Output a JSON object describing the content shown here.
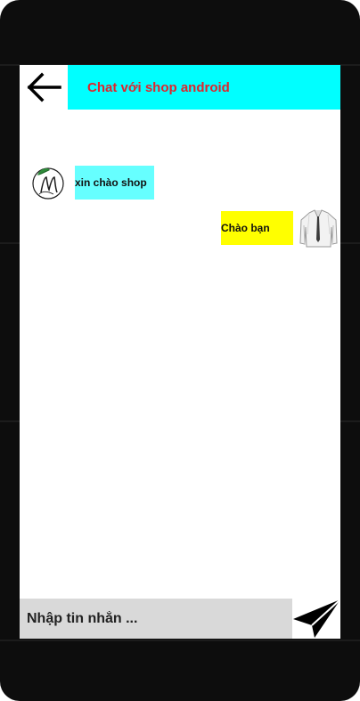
{
  "header": {
    "back_icon": "arrow-left-icon",
    "title": "Chat với shop android",
    "title_color": "#e0242b",
    "title_bg": "#00ffff"
  },
  "messages": [
    {
      "side": "left",
      "text": "xin chào shop",
      "avatar_icon": "shop-logo-avatar",
      "bg": "#66ffff"
    },
    {
      "side": "right",
      "text": "Chào bạn",
      "avatar_icon": "shirt-avatar",
      "bg": "#ffff00"
    }
  ],
  "composer": {
    "placeholder": "Nhập tin nhắn ...",
    "value": "",
    "send_icon": "send-icon"
  }
}
